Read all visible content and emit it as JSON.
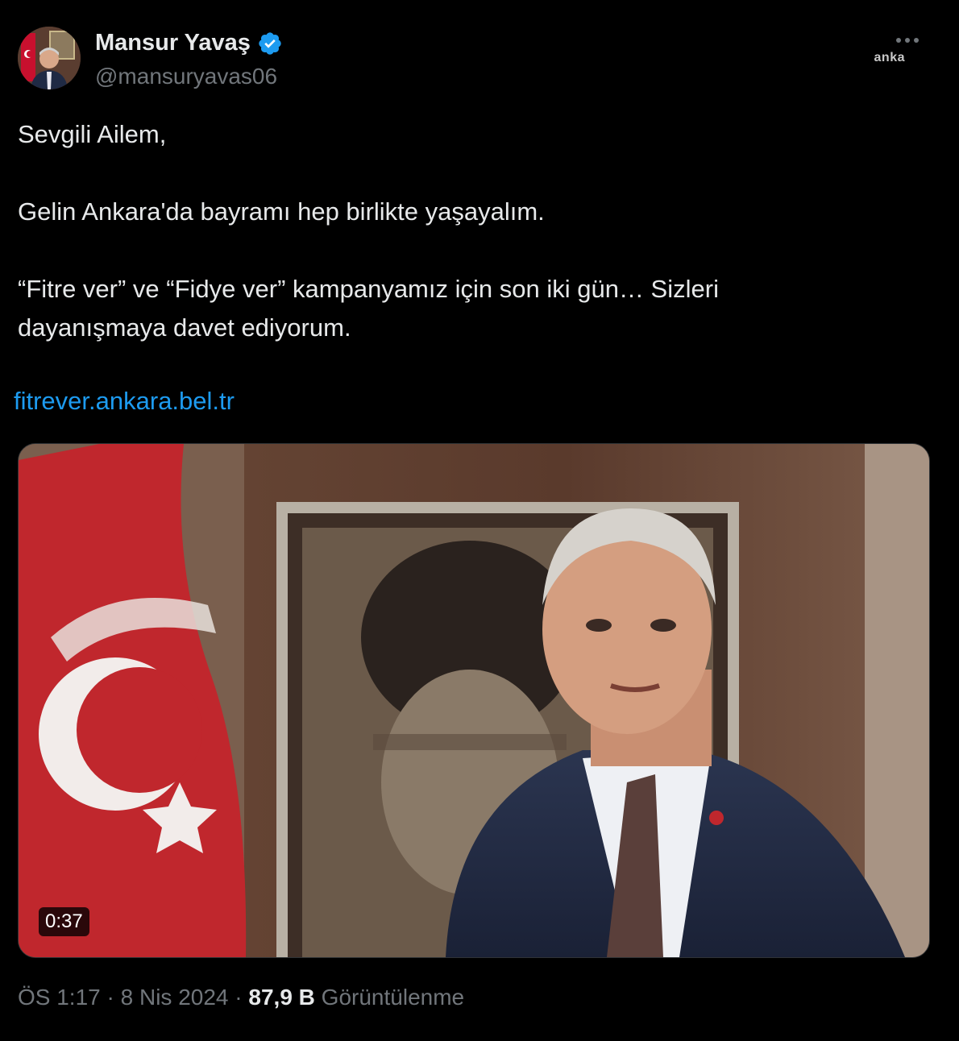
{
  "author": {
    "name": "Mansur Yavaş",
    "handle": "@mansuryavas06"
  },
  "watermark": "anka",
  "tweet": {
    "text": "Sevgili Ailem,\n\nGelin Ankara'da bayramı hep birlikte yaşayalım.\n\n“Fitre ver” ve “Fidye ver” kampanyamız için son iki gün… Sizleri\ndayanışmaya davet ediyorum.",
    "link": "fitrever.ankara.bel.tr"
  },
  "media": {
    "duration": "0:37"
  },
  "meta": {
    "time": "ÖS 1:17",
    "sep1": " · ",
    "date": "8 Nis 2024",
    "sep2": " · ",
    "views": "87,9 B",
    "views_label": " Görüntülenme"
  },
  "icons": {
    "verified": "verified-badge-icon",
    "more": "more-icon"
  },
  "colors": {
    "background": "#000000",
    "text": "#e7e9ea",
    "secondary": "#71767b",
    "link": "#1d9bf0",
    "verified": "#1d9bf0"
  }
}
